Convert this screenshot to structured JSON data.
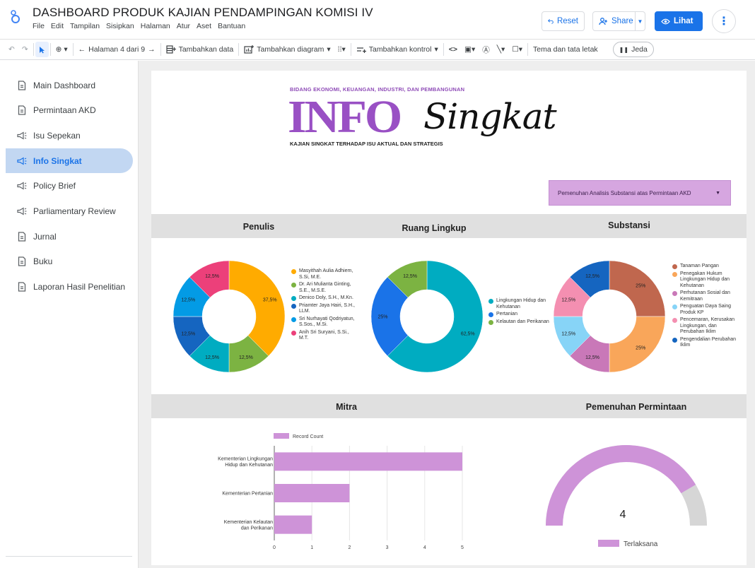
{
  "app": {
    "title": "DASHBOARD PRODUK KAJIAN PENDAMPINGAN KOMISI IV",
    "menu": [
      "File",
      "Edit",
      "Tampilan",
      "Sisipkan",
      "Halaman",
      "Atur",
      "Aset",
      "Bantuan"
    ],
    "buttons": {
      "reset": "Reset",
      "share": "Share",
      "view": "Lihat"
    }
  },
  "toolbar": {
    "page_nav": "Halaman 4 dari 9",
    "add_data": "Tambahkan data",
    "add_chart": "Tambahkan diagram",
    "add_control": "Tambahkan kontrol",
    "theme": "Tema dan tata letak",
    "pause": "Jeda"
  },
  "sidebar": {
    "items": [
      {
        "label": "Main Dashboard",
        "icon": "document-icon"
      },
      {
        "label": "Permintaan AKD",
        "icon": "document-icon"
      },
      {
        "label": "Isu Sepekan",
        "icon": "megaphone-icon"
      },
      {
        "label": "Info Singkat",
        "icon": "megaphone-icon",
        "active": true
      },
      {
        "label": "Policy Brief",
        "icon": "megaphone-icon"
      },
      {
        "label": "Parliamentary Review",
        "icon": "megaphone-icon"
      },
      {
        "label": "Jurnal",
        "icon": "document-icon"
      },
      {
        "label": "Buku",
        "icon": "document-icon"
      },
      {
        "label": "Laporan Hasil Penelitian",
        "icon": "document-icon"
      }
    ]
  },
  "report": {
    "brand_top": "BIDANG EKONOMI, KEUANGAN, INDUSTRI, DAN PEMBANGUNAN",
    "brand_info": "INFO",
    "brand_singkat": "Singkat",
    "brand_sub": "KAJIAN SINGKAT TERHADAP ISU AKTUAL DAN STRATEGIS",
    "filter": "Pemenuhan Analisis Substansi atas Permintaan AKD",
    "sections": {
      "penulis": "Penulis",
      "ruang_lingkup": "Ruang Lingkup",
      "substansi": "Substansi",
      "mitra": "Mitra",
      "pemenuhan": "Pemenuhan Permintaan"
    }
  },
  "chart_data": [
    {
      "type": "pie",
      "id": "penulis",
      "hole": true,
      "labels": [
        "Masyithah Aulia Adhiem, S.Si, M.E.",
        "Dr. Ari Mulianta Ginting, S.E., M.S.E.",
        "Denico Doly, S.H., M.Kn.",
        "Priamter Jaya Hairi, S.H., LLM.",
        "Sri Nurhayati Qodriyatun, S.Sos., M.Si.",
        "Anih Sri Suryani, S.Si., M.T."
      ],
      "values": [
        37.5,
        12.5,
        12.5,
        12.5,
        12.5,
        12.5
      ],
      "data_labels": [
        "37,5%",
        "12,5%",
        "12,5%",
        "12,5%",
        "12,5%",
        "12,5%"
      ],
      "colors": [
        "#ffab00",
        "#7cb342",
        "#00acc1",
        "#1565c0",
        "#039be5",
        "#ec407a"
      ]
    },
    {
      "type": "pie",
      "id": "ruang_lingkup",
      "hole": true,
      "labels": [
        "Lingkungan Hidup dan Kehutanan",
        "Pertanian",
        "Kelautan dan Perikanan"
      ],
      "values": [
        62.5,
        25,
        12.5
      ],
      "data_labels": [
        "62,5%",
        "25%",
        "12,5%"
      ],
      "colors": [
        "#00acc1",
        "#1a73e8",
        "#7cb342"
      ]
    },
    {
      "type": "pie",
      "id": "substansi",
      "hole": true,
      "labels": [
        "Tanaman Pangan",
        "Penegakan Hukum Lingkungan Hidup dan Kehutanan",
        "Perhutanan Sosial dan Kemitraan",
        "Penguatan Daya Saing Produk KP",
        "Pencemaran, Kerusakan Lingkungan, dan Perubahan Iklim",
        "Pengendalian Perubahan Iklim"
      ],
      "values": [
        25,
        25,
        12.5,
        12.5,
        12.5,
        12.5
      ],
      "data_labels": [
        "25%",
        "25%",
        "12,5%",
        "12,5%",
        "12,5%",
        "12,5%"
      ],
      "colors": [
        "#c0674e",
        "#f9a65a",
        "#c978b8",
        "#87d4f7",
        "#f48fb1",
        "#1565c0"
      ]
    },
    {
      "type": "bar",
      "id": "mitra",
      "orientation": "horizontal",
      "categories": [
        "Kementerian Lingkungan Hidup dan Kehutanan",
        "Kementerian Pertanian",
        "Kementerian Kelautan dan Perikanan"
      ],
      "series": [
        {
          "name": "Record Count",
          "values": [
            5,
            2,
            1
          ]
        }
      ],
      "xlim": [
        0,
        5
      ],
      "xticks": [
        0,
        1,
        2,
        3,
        4,
        5
      ],
      "grid": true,
      "legend": "top",
      "color": "#ce93d8"
    },
    {
      "type": "gauge",
      "id": "pemenuhan",
      "value": 4,
      "value_label": "4",
      "fill_fraction": 0.83,
      "legend": "Terlaksana",
      "color": "#ce93d8",
      "track_color": "#d6d6d6"
    }
  ]
}
